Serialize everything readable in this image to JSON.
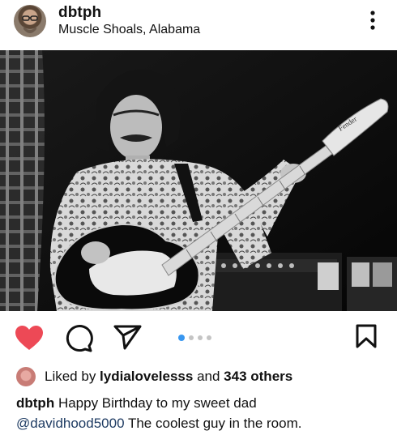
{
  "post": {
    "username": "dbtph",
    "location": "Muscle Shoals, Alabama"
  },
  "header": {
    "more_icon": "more-vertical-icon"
  },
  "photo": {
    "headstock_text": "Fender"
  },
  "actions": {
    "liked": true,
    "like_color": "#ed4956",
    "carousel": {
      "count": 4,
      "active_index": 0,
      "active_color": "#3897f0"
    }
  },
  "likes": {
    "prefix": "Liked by ",
    "liker": "lydialovelesss",
    "middle": " and ",
    "others": "343 others"
  },
  "caption": {
    "username": "dbtph",
    "text_before": "Happy Birthday to my sweet dad",
    "mention": "@davidhood5000",
    "text_after": "The coolest guy in the room."
  }
}
